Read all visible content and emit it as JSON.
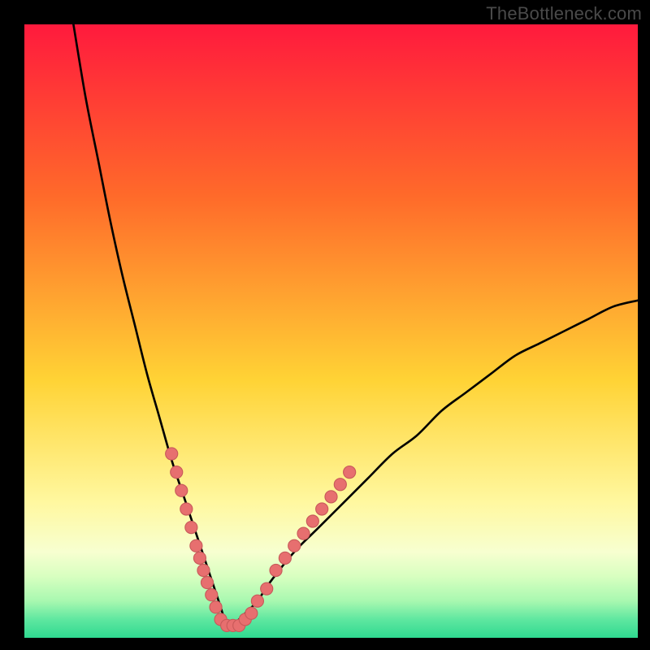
{
  "watermark": "TheBottleneck.com",
  "colors": {
    "black": "#000000",
    "curve": "#000000",
    "dot_fill": "#e76f6f",
    "dot_stroke": "#c85a5a",
    "grad_top": "#ff1a3d",
    "grad_upper_mid": "#ff6a2a",
    "grad_mid": "#ffd335",
    "grad_lower_mid": "#fff8a0",
    "grad_band1": "#f7ffd0",
    "grad_band2": "#d8ffc0",
    "grad_band3": "#a8f8b0",
    "grad_band4": "#5fe7a0",
    "grad_bottom": "#2fd990"
  },
  "chart_data": {
    "type": "line",
    "title": "",
    "xlabel": "",
    "ylabel": "",
    "xlim": [
      0,
      100
    ],
    "ylim": [
      0,
      100
    ],
    "notes": "V-shaped bottleneck curve. y ≈ |x - 33| scaled; minimum ~0 at x≈33. Left branch rises to ~100 at x≈8; right branch rises to ~55 at x≈100. Pink dots cluster on both branches near the valley (y ≲ 30).",
    "series": [
      {
        "name": "bottleneck-curve",
        "x": [
          8,
          10,
          12,
          14,
          16,
          18,
          20,
          22,
          24,
          26,
          28,
          30,
          31,
          32,
          33,
          34,
          35,
          36,
          38,
          40,
          44,
          48,
          52,
          56,
          60,
          64,
          68,
          72,
          76,
          80,
          84,
          88,
          92,
          96,
          100
        ],
        "y": [
          100,
          88,
          78,
          68,
          59,
          51,
          43,
          36,
          29,
          23,
          17,
          11,
          8,
          5,
          2,
          2,
          3,
          4,
          6,
          9,
          14,
          18,
          22,
          26,
          30,
          33,
          37,
          40,
          43,
          46,
          48,
          50,
          52,
          54,
          55
        ]
      }
    ],
    "dots": {
      "name": "cluster-dots",
      "points": [
        {
          "x": 24.0,
          "y": 30
        },
        {
          "x": 24.8,
          "y": 27
        },
        {
          "x": 25.6,
          "y": 24
        },
        {
          "x": 26.4,
          "y": 21
        },
        {
          "x": 27.2,
          "y": 18
        },
        {
          "x": 28.0,
          "y": 15
        },
        {
          "x": 28.6,
          "y": 13
        },
        {
          "x": 29.2,
          "y": 11
        },
        {
          "x": 29.8,
          "y": 9
        },
        {
          "x": 30.5,
          "y": 7
        },
        {
          "x": 31.2,
          "y": 5
        },
        {
          "x": 32.0,
          "y": 3
        },
        {
          "x": 33.0,
          "y": 2
        },
        {
          "x": 34.0,
          "y": 2
        },
        {
          "x": 35.0,
          "y": 2
        },
        {
          "x": 36.0,
          "y": 3
        },
        {
          "x": 37.0,
          "y": 4
        },
        {
          "x": 38.0,
          "y": 6
        },
        {
          "x": 39.5,
          "y": 8
        },
        {
          "x": 41.0,
          "y": 11
        },
        {
          "x": 42.5,
          "y": 13
        },
        {
          "x": 44.0,
          "y": 15
        },
        {
          "x": 45.5,
          "y": 17
        },
        {
          "x": 47.0,
          "y": 19
        },
        {
          "x": 48.5,
          "y": 21
        },
        {
          "x": 50.0,
          "y": 23
        },
        {
          "x": 51.5,
          "y": 25
        },
        {
          "x": 53.0,
          "y": 27
        }
      ]
    }
  }
}
